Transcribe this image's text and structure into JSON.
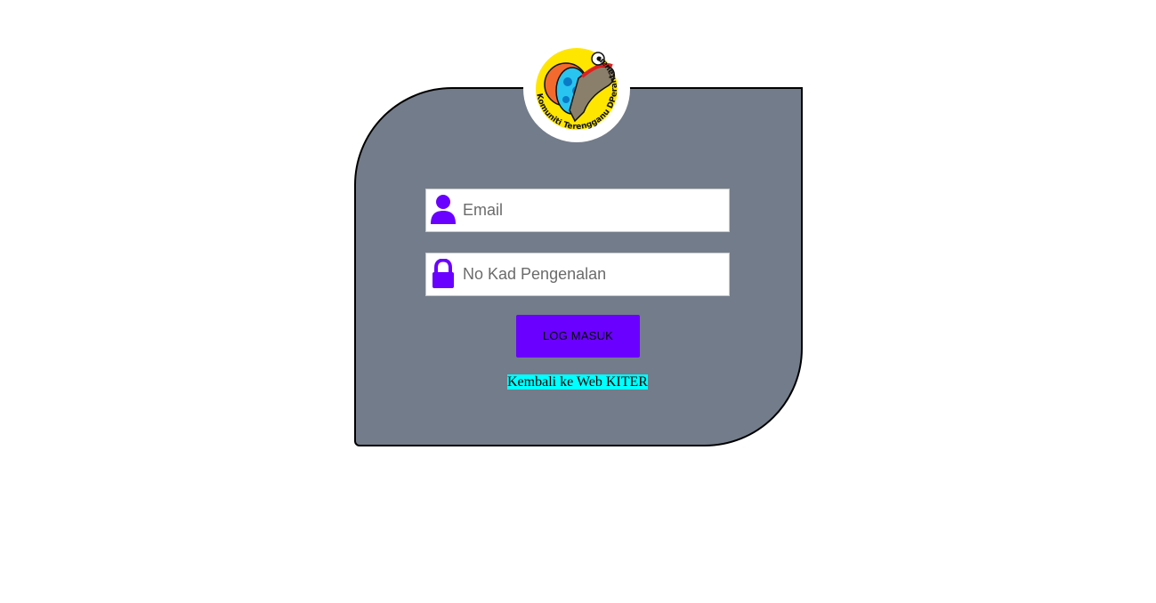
{
  "logo": {
    "ring_text": "Komuniti Terengganu DPerantauan",
    "ring_text_parts": [
      "Komuniti",
      "Terengganu",
      "DPerantauan"
    ]
  },
  "form": {
    "email": {
      "placeholder": "Email",
      "value": "",
      "icon": "user-icon"
    },
    "ic_number": {
      "placeholder": "No Kad Pengenalan",
      "value": "",
      "icon": "lock-icon"
    },
    "login_label": "LOG MASUK"
  },
  "back_link": {
    "label": "Kembali ke Web KITER"
  },
  "colors": {
    "card_background": "#737c8a",
    "accent": "#6a00ff",
    "link_highlight": "#00ffff",
    "logo_yellow": "#ffe600",
    "logo_orange": "#f26a2e",
    "logo_cyan": "#29c4f0"
  }
}
